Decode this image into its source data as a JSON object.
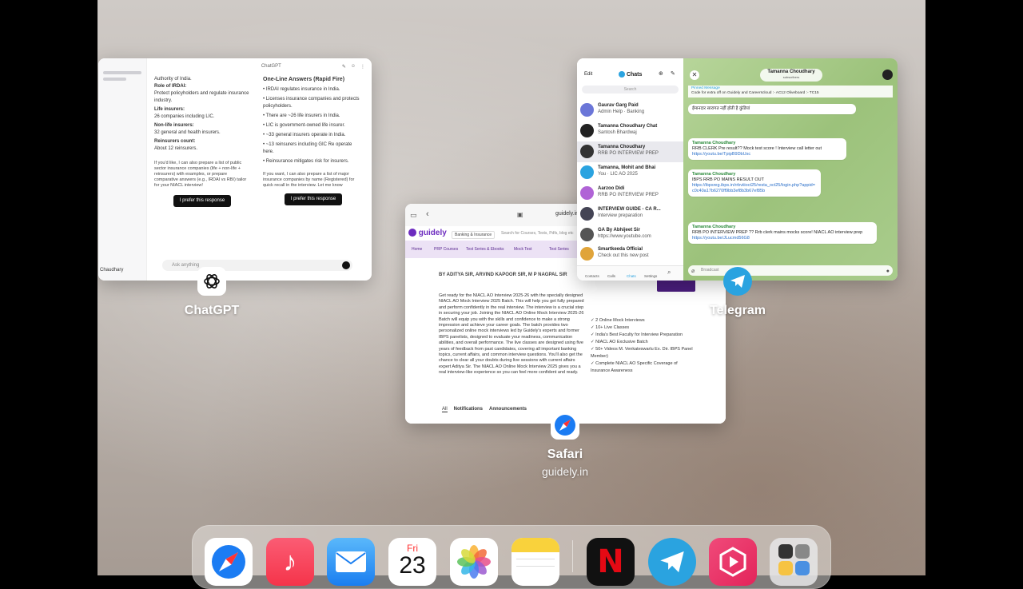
{
  "app_switcher": {
    "chatgpt": {
      "label": "ChatGPT",
      "header_title": "ChatGPT",
      "left_col": [
        "Authority of India.",
        "Role of IRDAI:",
        "Protect policyholders and regulate insurance industry.",
        "Life insurers:",
        "26 companies including LIC.",
        "Non-life insurers:",
        "32 general and health insurers.",
        "Reinsurers count:",
        "About 12 reinsurers."
      ],
      "left_note": "If you'd like, I can also prepare a list of public sector insurance companies (life + non-life + reinsurers) with examples, or prepare comparative answers (e.g., IRDAI vs RBI) tailor for your NIACL interview!",
      "right_heading": "One-Line Answers (Rapid Fire)",
      "right_items": [
        "IRDAI regulates insurance in India.",
        "Licenses insurance companies and protects policyholders.",
        "There are ~26 life insurers in India.",
        "LIC is government-owned life insurer.",
        "~33 general insurers operate in India.",
        "~13 reinsurers including GIC Re operate here.",
        "Reinsurance mitigates risk for insurers."
      ],
      "right_note": "If you want, I can also prepare a list of major insurance companies by name (Registered) for quick recall in the interview. Let me know",
      "prefer_btn": "I prefer this response",
      "prefer_btn_right": "I prefer this response",
      "input_placeholder": "Ask anything",
      "sidebar_bottom": "Chaudhary"
    },
    "safari": {
      "label": "Safari",
      "sublabel": "guidely.in",
      "url": "guidely.in",
      "brand": "guidely",
      "nav_dropdown": "Banking & Insurance",
      "search_placeholder": "Search for Courses, Tests, Pdfs, blog etc",
      "menu_items": [
        "Home",
        "PRP Courses",
        "Test Series & Ebooks",
        "Mock Test",
        "Test Series"
      ],
      "author_line": "BY ADITYA SIR, ARVIND KAPOOR SIR, M P NAGPAL SIR",
      "paragraph": "Get ready for the NIACL AO Interview 2025-26 with the specially designed NIACL AO Mock Interview 2025 Batch. This will help you get fully prepared and perform confidently in the real interview. The interview is a crucial step in securing your job. Joining the NIACL AO Online Mock Interview 2025-26 Batch will equip you with the skills and confidence to make a strong impression and achieve your career goals. The batch provides two personalized online mock interviews led by Guidely's experts and former IBPS panelists, designed to evaluate your readiness, communication abilities, and overall performance. The live classes are designed using five years of feedback from past candidates, covering all important banking topics, current affairs, and common interview questions. You'll also get the chance to clear all your doubts during live sessions with current affairs expert Aditya Sir. The NIACL AO Online Mock Interview 2025 gives you a real interview-like experience so you can feel more confident and ready.",
      "features": [
        "2 Online Mock Interviews",
        "10+ Live Classes",
        "India's Best Faculty for Interview Preparation",
        "NIACL AO Exclusive Batch",
        "50+ Videos M. Venkateswarlu Ex. Dir. IBPS Panel Member)",
        "Complete NIACL AO Specific Coverage of Insurance Awareness"
      ],
      "tabs": [
        "All",
        "Notifications",
        "Announcements"
      ]
    },
    "telegram": {
      "label": "Telegram",
      "edit": "Edit",
      "chats_title": "Chats",
      "search": "Search",
      "channel_title": "Tamanna Choudhary",
      "channel_sub": "subscribers",
      "pinned_label": "Pinned Message",
      "pinned_text": "Code for extra off on Guidely and Careerscloud :- AC12 Oliveboard :- TC15",
      "chats": [
        {
          "name": "Gaurav Garg Paid",
          "msg": "Admin Help · Banking"
        },
        {
          "name": "Tamanna Choudhary Chat",
          "msg": "Santosh Bhardwaj"
        },
        {
          "name": "Tamanna Choudhary",
          "msg": "RRB PO INTERVIEW PREP"
        },
        {
          "name": "Tamanna, Mohit and Bhai",
          "msg": "You · LIC AO 2025"
        },
        {
          "name": "Aarzoo Didi",
          "msg": "RRB PO INTERVIEW PREP"
        },
        {
          "name": "INTERVIEW GUIDE - CA R...",
          "msg": "Interview preparation"
        },
        {
          "name": "GA By Abhijeet Sir",
          "msg": "https://www.youtube.com"
        },
        {
          "name": "Smartkeeda Official",
          "msg": "Check out this new post"
        }
      ],
      "tabbar": [
        "Contacts",
        "Calls",
        "Chats",
        "Settings"
      ],
      "messages": [
        {
          "sender": "",
          "text": "ईमानदार सारागत नहीं होती है कुंडियां"
        },
        {
          "sender": "Tamanna Choudhary",
          "text": "RRB CLERK Pre result?? Mock test score ! Interview call letter out",
          "link": "https://youtu.be/TpipB9DbUsc"
        },
        {
          "sender": "Tamanna Choudhary",
          "text": "IBPS RRB PO MAINS RESULT OUT",
          "link": "https://ibpsreg.ibps.in/rrbviiioct25/resta_oct25/login.php?appid=c0c40a17b6270ff9bb3ef8b3b67ef85b"
        },
        {
          "sender": "Tamanna Choudhary",
          "text": "RRB PO INTERVIEW PREP ?? Rrb clerk mains mocks score! NIACL AO interview prep",
          "link": "https://youtu.be/JLucmd56G8"
        }
      ],
      "message_placeholder": "Broadcast"
    }
  },
  "dock": {
    "calendar_day": "Fri",
    "calendar_date": "23",
    "apps": [
      "Safari",
      "Music",
      "Mail",
      "Calendar",
      "Photos",
      "Notes",
      "Netflix",
      "Telegram",
      "Screen Recorder",
      "Utilities"
    ]
  },
  "colors": {
    "guidely_purple": "#6c2bbf",
    "telegram_blue": "#2aa3e0",
    "safari_blue": "#1b7cf3",
    "music_red": "#f5344a",
    "netflix_red": "#e50914"
  }
}
